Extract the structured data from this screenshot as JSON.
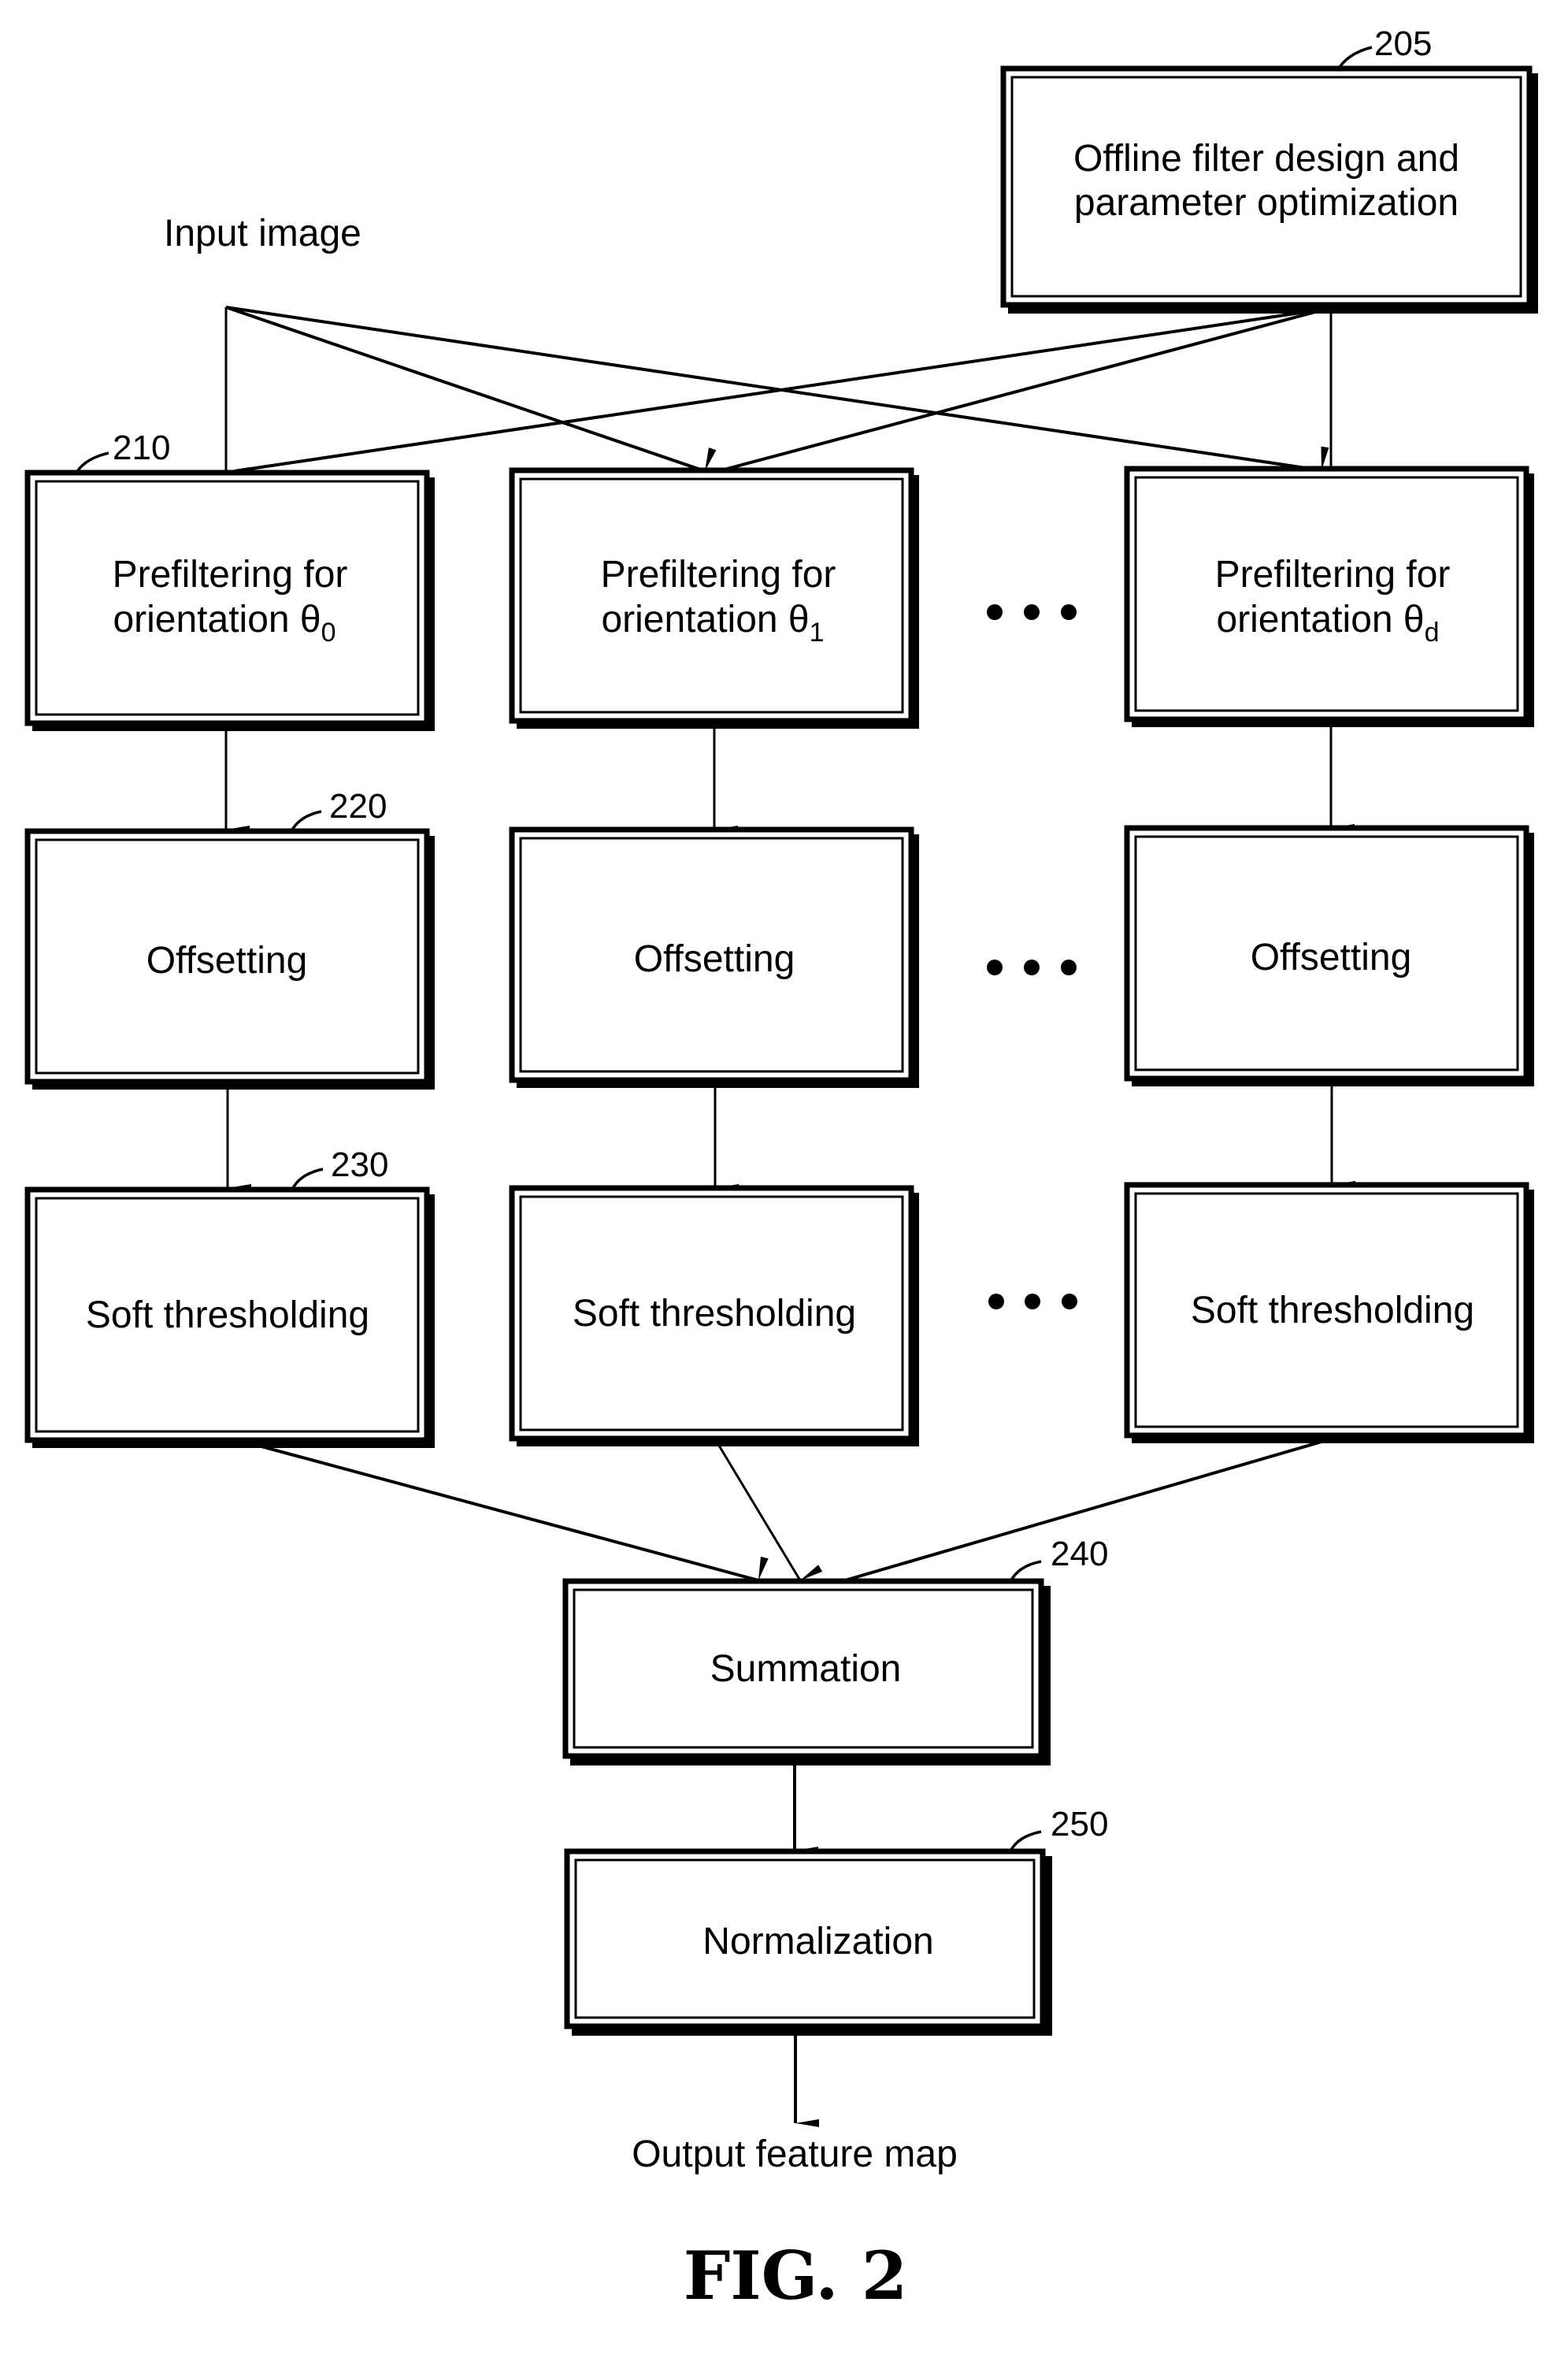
{
  "figure": {
    "caption": "FIG. 2",
    "input_label": "Input image",
    "output_label": "Output feature map",
    "ellipsis_symbol": "•••"
  },
  "blocks": {
    "offline": {
      "ref": "205",
      "lines": [
        "Offline filter design and",
        "parameter optimization"
      ]
    },
    "prefilter": {
      "ref": "210",
      "line1": "Prefiltering for",
      "line2_prefix": "orientation θ",
      "columns": [
        {
          "subscript": "0"
        },
        {
          "subscript": "1"
        },
        {
          "subscript": "d"
        }
      ]
    },
    "offsetting": {
      "ref": "220",
      "label": "Offsetting"
    },
    "soft_thresholding": {
      "ref": "230",
      "label": "Soft thresholding"
    },
    "summation": {
      "ref": "240",
      "label": "Summation"
    },
    "normalization": {
      "ref": "250",
      "label": "Normalization"
    }
  }
}
